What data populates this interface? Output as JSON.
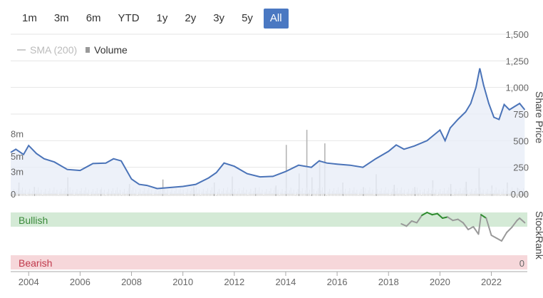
{
  "range_buttons": [
    "1m",
    "3m",
    "6m",
    "YTD",
    "1y",
    "2y",
    "3y",
    "5y",
    "All"
  ],
  "active_range": "All",
  "legend": {
    "sma_label": "SMA (200)",
    "volume_label": "Volume"
  },
  "colors": {
    "price": "#4a73b8",
    "price_fill": "#e8eef8",
    "volume": "#b5b5b5",
    "bullish_band": "#d4ead6",
    "bearish_band": "#f6d7da",
    "bullish_text": "#3a8a3a",
    "bearish_text": "#c0394b",
    "rank_high": "#2e8b2e",
    "rank_low": "#999999"
  },
  "chart_data": {
    "type": "line",
    "x_ticks": [
      "2004",
      "2006",
      "2008",
      "2010",
      "2012",
      "2014",
      "2016",
      "2018",
      "2020",
      "2022"
    ],
    "price_axis": {
      "title": "Share Price",
      "ticks": [
        "1,500",
        "1,250",
        "1,000",
        "750",
        "500",
        "250",
        "0.00"
      ],
      "ylim": [
        0,
        1500
      ]
    },
    "volume_axis": {
      "ticks": [
        "8m",
        "5m",
        "3m",
        "0"
      ]
    },
    "stockrank_axis": {
      "title": "StockRank",
      "bottom_label": "0",
      "bullish_label": "Bullish",
      "bearish_label": "Bearish"
    },
    "price_series": {
      "x": [
        2003.3,
        2003.5,
        2003.8,
        2004.0,
        2004.3,
        2004.6,
        2005.0,
        2005.5,
        2006.0,
        2006.5,
        2007.0,
        2007.3,
        2007.6,
        2008.0,
        2008.3,
        2008.6,
        2009.0,
        2009.5,
        2010.0,
        2010.5,
        2011.0,
        2011.3,
        2011.6,
        2012.0,
        2012.5,
        2013.0,
        2013.5,
        2014.0,
        2014.5,
        2015.0,
        2015.3,
        2015.6,
        2016.0,
        2016.5,
        2017.0,
        2017.5,
        2018.0,
        2018.3,
        2018.6,
        2019.0,
        2019.5,
        2020.0,
        2020.2,
        2020.4,
        2020.7,
        2021.0,
        2021.2,
        2021.4,
        2021.55,
        2021.7,
        2021.9,
        2022.1,
        2022.3,
        2022.5,
        2022.7,
        2022.9,
        2023.1,
        2023.3
      ],
      "y": [
        390,
        420,
        370,
        455,
        380,
        330,
        300,
        230,
        220,
        285,
        290,
        330,
        310,
        140,
        90,
        80,
        50,
        60,
        70,
        90,
        150,
        200,
        290,
        260,
        190,
        160,
        165,
        210,
        270,
        250,
        310,
        290,
        280,
        270,
        250,
        330,
        400,
        460,
        420,
        450,
        500,
        600,
        500,
        620,
        700,
        770,
        850,
        1000,
        1180,
        1020,
        850,
        720,
        700,
        840,
        790,
        820,
        850,
        790
      ]
    },
    "volume_series": {
      "x": [
        2003.6,
        2004.2,
        2005.5,
        2006.8,
        2007.9,
        2009.2,
        2010.4,
        2011.2,
        2011.9,
        2012.8,
        2013.6,
        2014.0,
        2014.5,
        2014.8,
        2015.0,
        2015.3,
        2015.5,
        2016.2,
        2017.0,
        2017.5,
        2018.2,
        2019.0,
        2019.7,
        2020.4,
        2021.0,
        2021.5,
        2022.0,
        2022.6,
        2023.0
      ],
      "y": [
        1.8,
        1.2,
        2.5,
        0.9,
        1.6,
        2.2,
        1.3,
        1.8,
        2.6,
        1.1,
        1.4,
        6.8,
        3.0,
        8.8,
        2.5,
        4.8,
        7.0,
        1.8,
        1.2,
        2.9,
        1.5,
        1.2,
        2.1,
        1.6,
        1.9,
        3.7,
        1.4,
        1.8,
        1.1
      ]
    },
    "stockrank_series": {
      "x": [
        2018.5,
        2018.7,
        2018.9,
        2019.1,
        2019.3,
        2019.5,
        2019.7,
        2019.9,
        2020.1,
        2020.3,
        2020.5,
        2020.7,
        2020.9,
        2021.1,
        2021.3,
        2021.5,
        2021.6,
        2021.8,
        2022.0,
        2022.2,
        2022.4,
        2022.6,
        2022.8,
        2023.0,
        2023.1,
        2023.3
      ],
      "y": [
        80,
        76,
        85,
        82,
        95,
        100,
        96,
        98,
        90,
        92,
        86,
        88,
        82,
        70,
        75,
        62,
        96,
        90,
        60,
        55,
        50,
        65,
        74,
        86,
        90,
        82
      ]
    }
  }
}
